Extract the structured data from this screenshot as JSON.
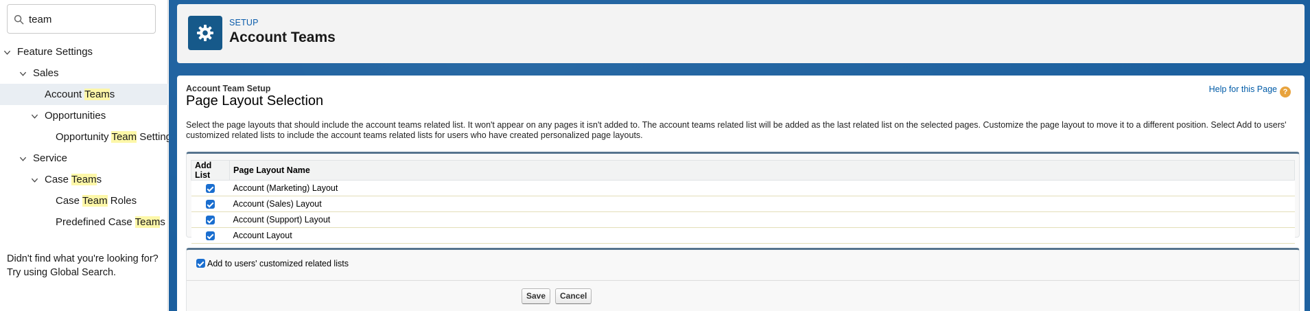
{
  "search": {
    "value": "team",
    "icon": "search-icon"
  },
  "tree": [
    {
      "label": "Feature Settings",
      "pre": "",
      "hl": "",
      "post": ""
    },
    {
      "label": "Sales",
      "pre": "",
      "hl": "",
      "post": ""
    },
    {
      "label": "",
      "pre": "Account ",
      "hl": "Team",
      "post": "s"
    },
    {
      "label": "Opportunities",
      "pre": "",
      "hl": "",
      "post": ""
    },
    {
      "label": "",
      "pre": "Opportunity ",
      "hl": "Team",
      "post": " Settings"
    },
    {
      "label": "Service",
      "pre": "",
      "hl": "",
      "post": ""
    },
    {
      "label": "",
      "pre": "Case ",
      "hl": "Team",
      "post": "s"
    },
    {
      "label": "",
      "pre": "Case ",
      "hl": "Team",
      "post": " Roles"
    },
    {
      "label": "",
      "pre": "Predefined Case ",
      "hl": "Team",
      "post": "s"
    }
  ],
  "not_found": {
    "line1": "Didn't find what you're looking for?",
    "line2": "Try using Global Search."
  },
  "header": {
    "eyebrow": "SETUP",
    "title": "Account Teams"
  },
  "content": {
    "subtitle": "Account Team Setup",
    "title": "Page Layout Selection",
    "help_link": "Help for this Page",
    "help_icon": "?",
    "description": "Select the page layouts that should include the account teams related list. It won't appear on any pages it isn't added to. The account teams related list will be added as the last related list on the selected pages. Customize the page layout to move it to a different position. Select Add to users' customized related lists to include the account teams related lists for users who have created personalized page layouts."
  },
  "table": {
    "headers": [
      "Add List",
      "Page Layout Name"
    ],
    "rows": [
      {
        "checked": true,
        "name": "Account (Marketing) Layout"
      },
      {
        "checked": true,
        "name": "Account (Sales) Layout"
      },
      {
        "checked": true,
        "name": "Account (Support) Layout"
      },
      {
        "checked": true,
        "name": "Account Layout"
      }
    ]
  },
  "options": {
    "add_to_customized_label": "Add to users' customized related lists",
    "add_to_customized_checked": true
  },
  "buttons": {
    "save": "Save",
    "cancel": "Cancel"
  },
  "colors": {
    "brand_blue": "#1b5f9e",
    "icon_bg": "#16598a",
    "highlight": "#fdf7a8",
    "checkbox": "#1a6ecf"
  }
}
